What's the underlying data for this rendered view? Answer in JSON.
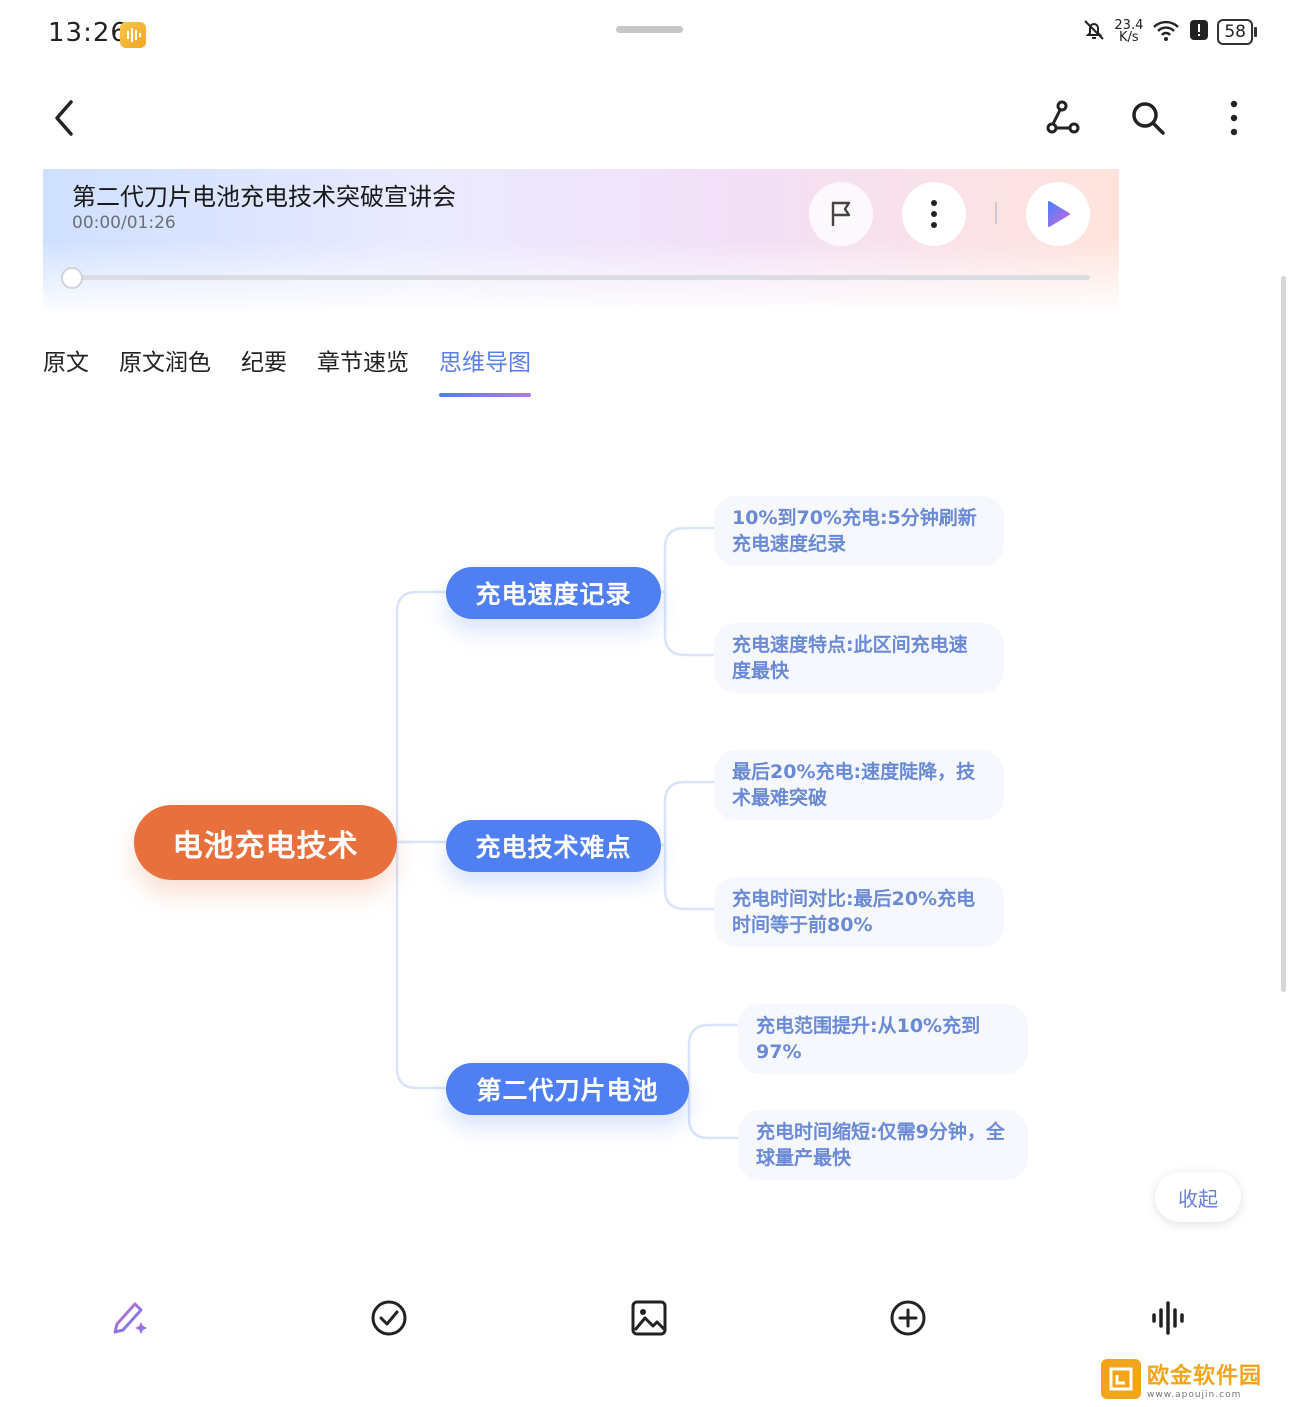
{
  "status_bar": {
    "time": "13:26",
    "net_speed_value": "23.4",
    "net_speed_unit": "K/s",
    "battery": "58",
    "icons": [
      "mute-bell-icon",
      "wifi-icon",
      "alert-icon",
      "battery-icon"
    ]
  },
  "toolbar": {
    "icons": [
      "back-arrow-icon",
      "share-graph-icon",
      "search-icon",
      "more-vertical-icon"
    ]
  },
  "recording": {
    "title": "第二代刀片电池充电技术突破宣讲会",
    "time": "00:00/01:26",
    "progress": 0,
    "icons": [
      "flag-icon",
      "more-vertical-icon",
      "play-icon"
    ]
  },
  "tabs": [
    {
      "label": "原文"
    },
    {
      "label": "原文润色"
    },
    {
      "label": "纪要"
    },
    {
      "label": "章节速览"
    },
    {
      "label": "思维导图",
      "active": true
    }
  ],
  "mindmap": {
    "root": "电池充电技术",
    "branches": [
      {
        "label": "充电速度记录",
        "leaves": [
          "10%到70%充电:5分钟刷新充电速度纪录",
          "充电速度特点:此区间充电速度最快"
        ]
      },
      {
        "label": "充电技术难点",
        "leaves": [
          "最后20%充电:速度陡降，技术最难突破",
          "充电时间对比:最后20%充电时间等于前80%"
        ]
      },
      {
        "label": "第二代刀片电池",
        "leaves": [
          "充电范围提升:从10%充到97%",
          "充电时间缩短:仅需9分钟，全球量产最快"
        ]
      }
    ],
    "collapse_label": "收起"
  },
  "bottom_bar": {
    "icons": [
      "ai-pen-icon",
      "checklist-icon",
      "image-icon",
      "add-circle-icon",
      "waveform-icon"
    ]
  },
  "watermark": {
    "text": "欧金软件园",
    "sub": "www.apoujin.com",
    "color": "#f2a51a"
  },
  "colors": {
    "accent": "#4f7ff0",
    "root": "#e8703d",
    "leaf_text": "#6a8ad6"
  }
}
